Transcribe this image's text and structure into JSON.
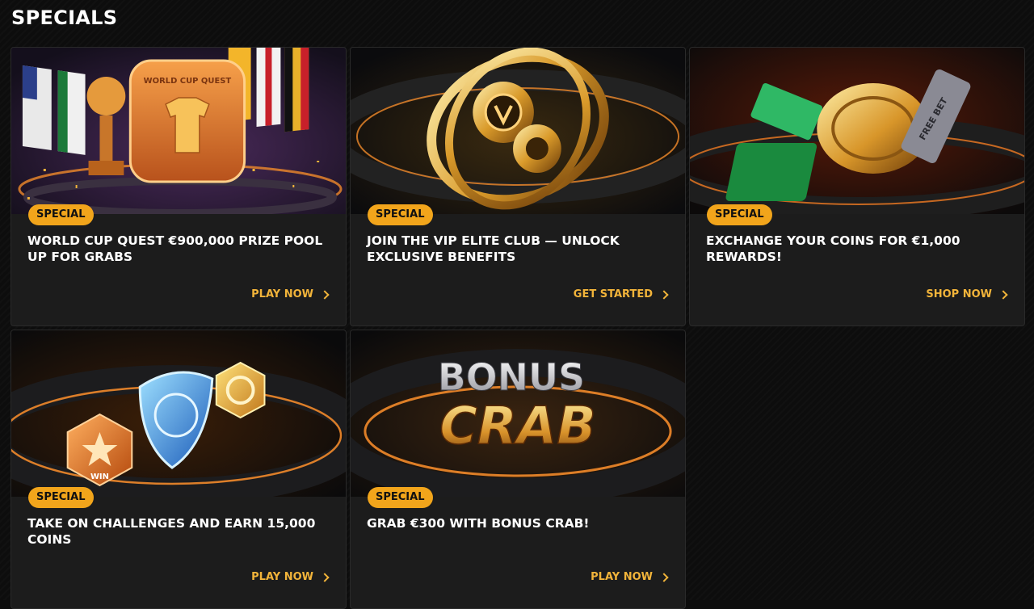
{
  "header": {
    "title": "SPECIALS"
  },
  "cards": [
    {
      "badge": "SPECIAL",
      "title": "WORLD CUP QUEST €900,000 PRIZE POOL UP FOR GRABS",
      "cta": "PLAY NOW",
      "art": {
        "icon": "world-cup-quest-art",
        "label": "WORLD CUP QUEST"
      }
    },
    {
      "badge": "SPECIAL",
      "title": "JOIN THE VIP ELITE CLUB — UNLOCK EXCLUSIVE BENEFITS",
      "cta": "GET STARTED",
      "art": {
        "icon": "vip-gyroscope-art"
      }
    },
    {
      "badge": "SPECIAL",
      "title": "EXCHANGE YOUR COINS FOR €1,000 REWARDS!",
      "cta": "SHOP NOW",
      "art": {
        "icon": "coin-shop-art",
        "label": "FREE BET"
      }
    },
    {
      "badge": "SPECIAL",
      "title": "TAKE ON CHALLENGES AND EARN 15,000 COINS",
      "cta": "PLAY NOW",
      "art": {
        "icon": "challenges-coins-art",
        "label": "WIN"
      }
    },
    {
      "badge": "SPECIAL",
      "title": "GRAB €300 WITH BONUS CRAB!",
      "cta": "PLAY NOW",
      "art": {
        "icon": "bonus-crab-art",
        "label_top": "BONUS",
        "label_bottom": "CRAB"
      }
    }
  ],
  "colors": {
    "badge": "#f2a51b",
    "cta": "#f2b43a",
    "card_bg": "#1c1c1c",
    "page_bg": "#0d0d0d"
  }
}
